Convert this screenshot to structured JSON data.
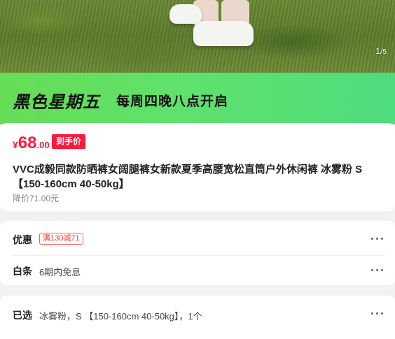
{
  "hero": {
    "counter_current": "1",
    "counter_total": "5"
  },
  "banner": {
    "tag": "黑色星期五",
    "subtitle": "每周四晚八点开启"
  },
  "price": {
    "currency": "¥",
    "integer": "68",
    "decimal": ".00",
    "badge": "到手价",
    "title": "VVC成毅同款防晒裤女阔腿裤女新款夏季高腰宽松直筒户外休闲裤 冰雾粉 S【150-160cm 40-50kg】",
    "original": "降价71.00元"
  },
  "discount": {
    "label": "优惠",
    "coupon": "满130减71"
  },
  "credit": {
    "label": "白条",
    "value": "6期内免息"
  },
  "selected": {
    "label": "已选",
    "value": "冰雾粉，S 【150-160cm 40-50kg】，1个"
  },
  "colors": {
    "accent": "#ff1a3c",
    "banner_green": "#5fe26c"
  }
}
